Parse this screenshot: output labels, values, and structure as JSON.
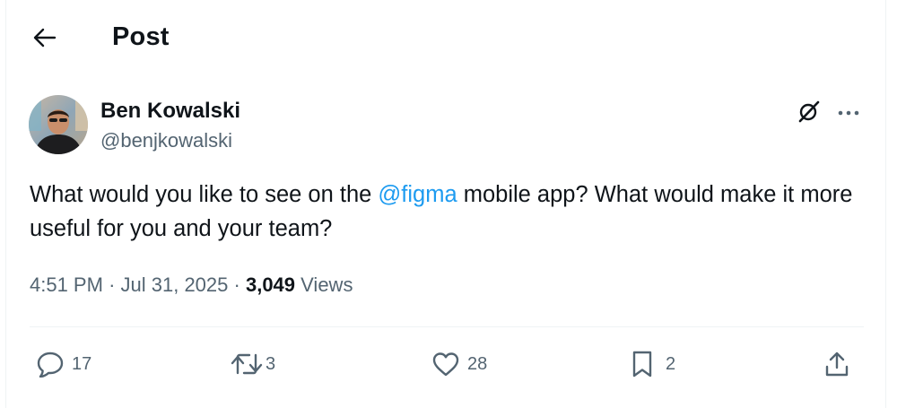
{
  "header": {
    "title": "Post",
    "back_icon": "arrow-left-icon"
  },
  "post": {
    "author": {
      "name": "Ben Kowalski",
      "handle": "@benjkowalski",
      "avatar": "avatar-photo"
    },
    "text": {
      "before_mention": "What would you like to see on the ",
      "mention": "@figma",
      "after_mention": " mobile app? What would make it more useful for you and your team?"
    },
    "meta": {
      "time": "4:51 PM",
      "separator": "·",
      "date": "Jul 31, 2025",
      "views_count": "3,049",
      "views_label": "Views"
    },
    "actions": {
      "reply": {
        "icon": "reply-icon",
        "count": "17"
      },
      "retweet": {
        "icon": "retweet-icon",
        "count": "3"
      },
      "like": {
        "icon": "heart-icon",
        "count": "28"
      },
      "bookmark": {
        "icon": "bookmark-icon",
        "count": "2"
      },
      "share": {
        "icon": "share-icon"
      }
    },
    "top_icons": [
      "grok-icon",
      "more-icon"
    ]
  },
  "colors": {
    "text_primary": "#0f1419",
    "text_secondary": "#536471",
    "link": "#1d9bf0",
    "divider": "#eff3f4"
  }
}
